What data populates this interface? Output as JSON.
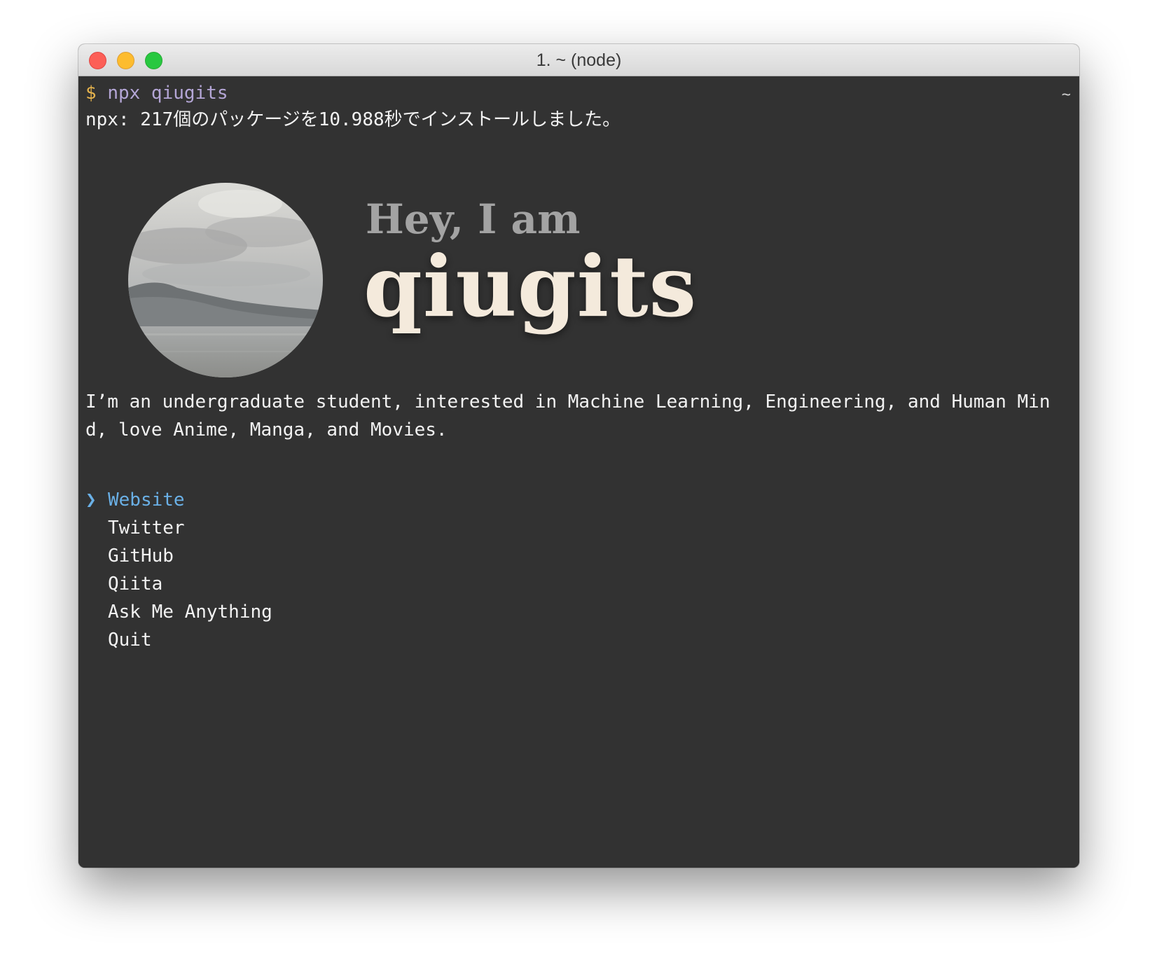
{
  "window": {
    "title": "1. ~ (node)",
    "tab_indicator": "~"
  },
  "terminal": {
    "prompt_sign": "$",
    "prompt_command": "npx qiugits",
    "install_message": "npx: 217個のパッケージを10.988秒でインストールしました。",
    "banner": {
      "greeting": "Hey, I am",
      "name": "qiugits",
      "avatar": "landscape-photo-avatar"
    },
    "bio_line1": "I’m an undergraduate student, interested in Machine Learning, Engineering, and Human Min",
    "bio_line2": "d, love Anime, Manga, and Movies.",
    "menu": {
      "pointer": "❯",
      "selected_index": 0,
      "items": [
        "Website",
        "Twitter",
        "GitHub",
        "Qiita",
        "Ask Me Anything",
        "Quit"
      ]
    }
  },
  "colors": {
    "terminal_bg": "#323232",
    "prompt_sign": "#e6b34d",
    "prompt_command": "#b4a6d6",
    "selection": "#6ab0e6",
    "text": "#f2f2f2"
  }
}
